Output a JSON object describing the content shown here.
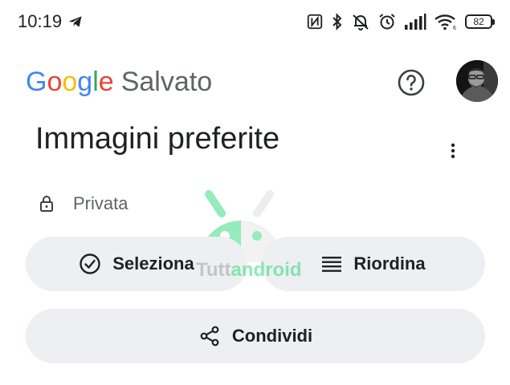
{
  "status_bar": {
    "time": "10:19",
    "battery": "82",
    "icons": [
      "telegram-icon",
      "nfc-icon",
      "bluetooth-icon",
      "silent-icon",
      "alarm-icon",
      "signal-icon",
      "wifi-icon",
      "battery-icon"
    ]
  },
  "header": {
    "logo_letters": [
      "G",
      "o",
      "o",
      "g",
      "l",
      "e"
    ],
    "logo_colors": [
      "#4285F4",
      "#EA4335",
      "#FBBC05",
      "#4285F4",
      "#34A853",
      "#EA4335"
    ],
    "section": "Salvato"
  },
  "collection": {
    "title": "Immagini preferite",
    "privacy": "Privata"
  },
  "actions": {
    "select": "Seleziona",
    "reorder": "Riordina",
    "share": "Condividi"
  },
  "watermark": {
    "part1": "Tutt",
    "part2": "android"
  },
  "colors": {
    "button_bg": "#eeeff2",
    "text_primary": "#202124",
    "text_secondary": "#5f6368",
    "watermark_green": "#3ddc84"
  }
}
